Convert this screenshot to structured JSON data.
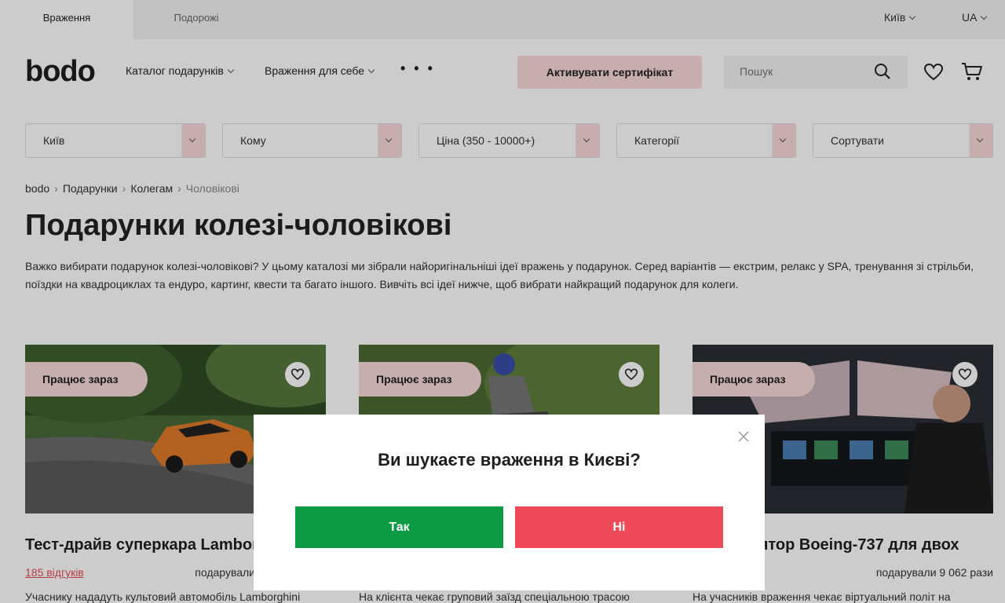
{
  "topbar": {
    "tab_active": "Враження",
    "tab_second": "Подорожі",
    "city": "Київ",
    "lang": "UA"
  },
  "header": {
    "logo": "bodo",
    "nav_catalog": "Каталог подарунків",
    "nav_self": "Враження для себе",
    "nav_more": "• • •",
    "activate_label": "Активувати сертифікат",
    "search_placeholder": "Пошук"
  },
  "filters": [
    {
      "label": "Київ"
    },
    {
      "label": "Кому"
    },
    {
      "label": "Ціна (350 - 10000+)"
    },
    {
      "label": "Категорії"
    },
    {
      "label": "Сортувати"
    }
  ],
  "breadcrumb": [
    "bodo",
    "Подарунки",
    "Колегам",
    "Чоловікові"
  ],
  "page": {
    "title": "Подарунки колезі-чоловікові",
    "description": "Важко вибирати подарунок колезі-чоловікові? У цьому каталозі ми зібрали найоригінальніші ідеї вражень у подарунок. Серед варіантів — екстрим, релакс у SPA, тренування зі стрільби, поїздки на квадроциклах та ендуро, картинг, квести та багато іншого. Вивчіть всі ідеї нижче, щоб вибрати найкращий подарунок для колеги."
  },
  "cards": [
    {
      "badge": "Працює зараз",
      "title": "Тест-драйв суперкара Lamborghini",
      "reviews": "185 відгуків",
      "gifted": "подарували",
      "desc": "Учаснику нададуть культовий автомобіль Lamborghini"
    },
    {
      "badge": "Працює зараз",
      "title": "",
      "reviews": "",
      "gifted": "",
      "desc": "На клієнта чекає груповий заїзд спеціальною трасою"
    },
    {
      "badge": "Працює зараз",
      "title": "лятор Boeing-737 для двох",
      "reviews": "",
      "gifted": "подарували 9 062 рази",
      "desc": "На учасників враження чекає віртуальний політ на"
    }
  ],
  "modal": {
    "title": "Ви шукаєте враження в Києві?",
    "yes": "Так",
    "no": "Ні"
  },
  "colors": {
    "accent_pink": "#fad9db",
    "yes_green": "#0d9a45",
    "no_red": "#ef4a5a"
  }
}
